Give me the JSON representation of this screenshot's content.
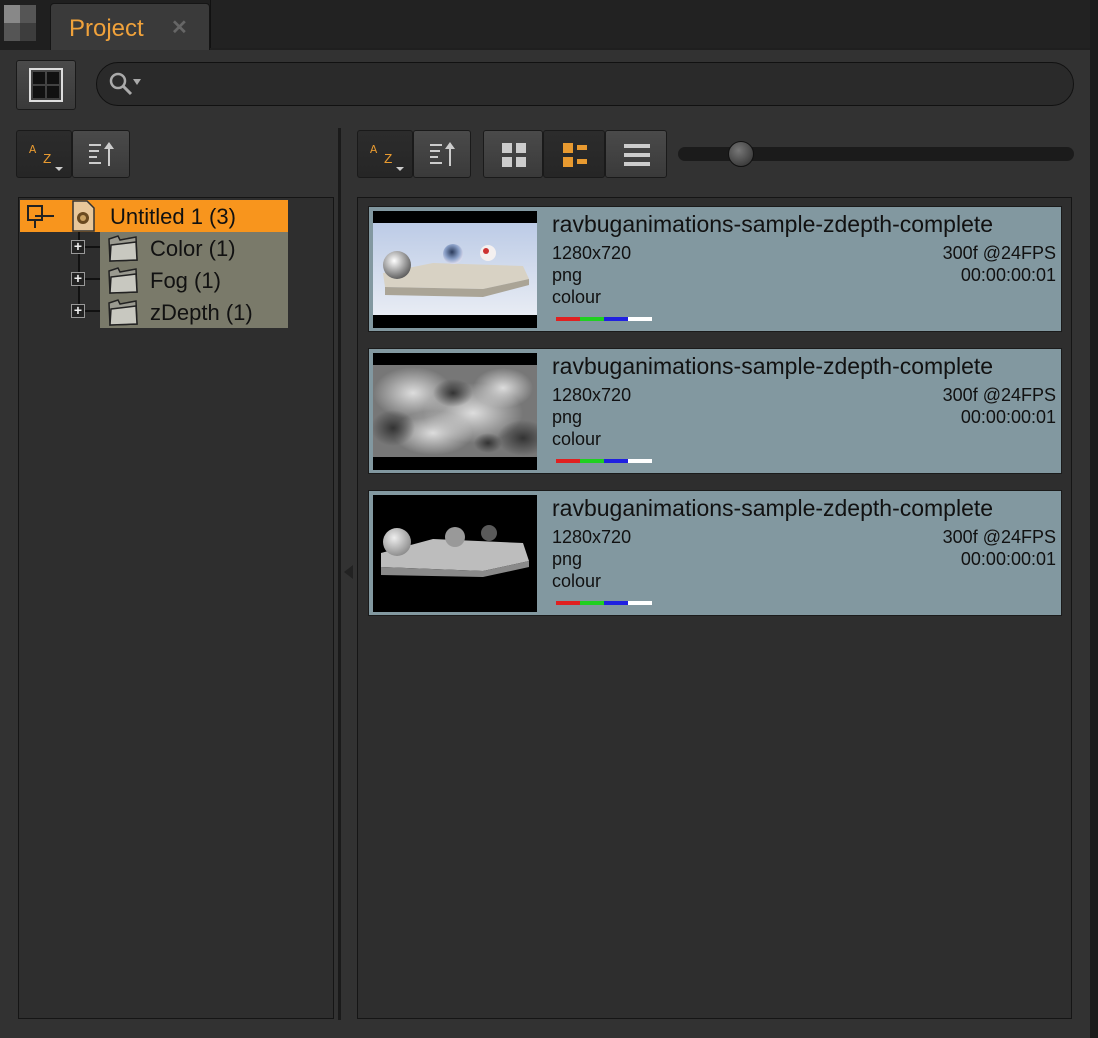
{
  "tab": {
    "title": "Project",
    "close": "✕"
  },
  "search": {
    "value": "",
    "placeholder": ""
  },
  "tree": {
    "root": {
      "label": "Untitled 1 (3)"
    },
    "bins": [
      {
        "label": "Color (1)"
      },
      {
        "label": "Fog (1)"
      },
      {
        "label": "zDepth (1)"
      }
    ]
  },
  "sort": {
    "az_label_a": "A",
    "az_label_z": "Z"
  },
  "view": {
    "active_mode": "list-with-details",
    "thumbnail_size_level": 0.2
  },
  "clips": [
    {
      "name": "ravbuganimations-sample-zdepth-complete",
      "resolution": "1280x720",
      "format": "png",
      "colorspace": "colour",
      "frames": "300f @24FPS",
      "timecode": "00:00:00:01",
      "thumb": "color-render"
    },
    {
      "name": "ravbuganimations-sample-zdepth-complete",
      "resolution": "1280x720",
      "format": "png",
      "colorspace": "colour",
      "frames": "300f @24FPS",
      "timecode": "00:00:00:01",
      "thumb": "fog-clouds"
    },
    {
      "name": "ravbuganimations-sample-zdepth-complete",
      "resolution": "1280x720",
      "format": "png",
      "colorspace": "colour",
      "frames": "300f @24FPS",
      "timecode": "00:00:00:01",
      "thumb": "zdepth-render"
    }
  ],
  "channel_colors": [
    "#e02020",
    "#20d020",
    "#2020e0",
    "#ffffff"
  ],
  "colors": {
    "accent": "#f8951d",
    "tab_text": "#f0a23b",
    "clip_bg": "#8298a0",
    "bin_bg": "#7a7a6a"
  }
}
